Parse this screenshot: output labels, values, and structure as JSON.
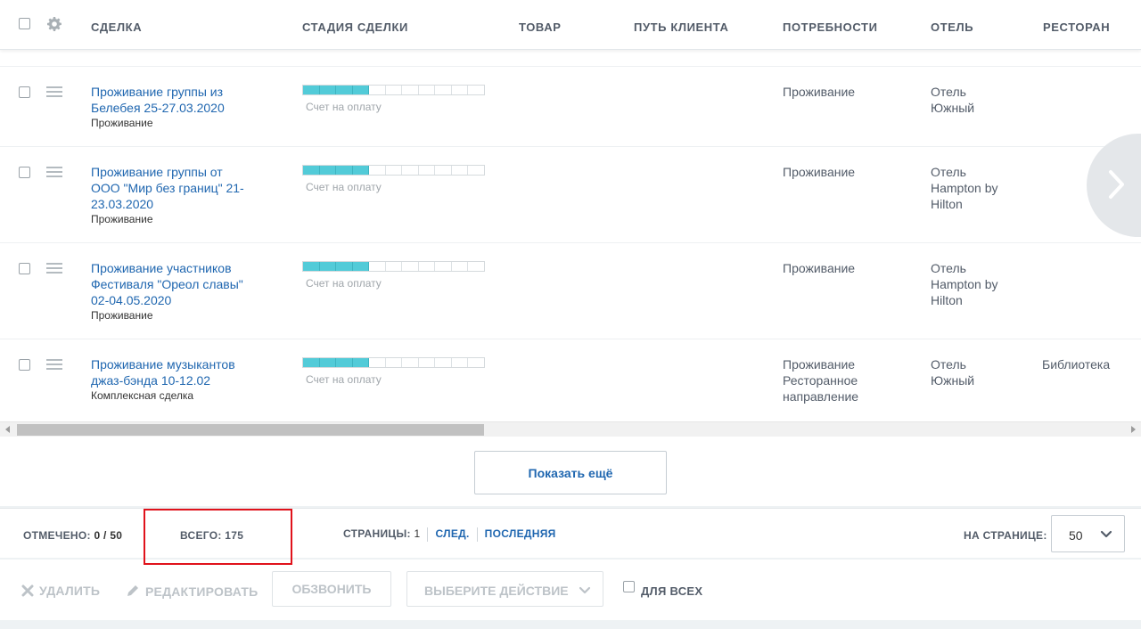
{
  "columns": {
    "deal": "СДЕЛКА",
    "stage": "СТАДИЯ СДЕЛКИ",
    "product": "ТОВАР",
    "journey": "ПУТЬ КЛИЕНТА",
    "needs": "ПОТРЕБНОСТИ",
    "hotel": "ОТЕЛЬ",
    "restaurant": "РЕСТОРАН"
  },
  "rows": [
    {
      "title_lines": [
        "Проживание группы из",
        "Белебея 25-27.03.2020"
      ],
      "type": "Проживание",
      "stage": "Счет на оплату",
      "stage_progress": {
        "filled": 4,
        "total": 11
      },
      "needs": [
        "Проживание"
      ],
      "hotel": [
        "Отель",
        "Южный"
      ],
      "restaurant": ""
    },
    {
      "title_lines": [
        "Проживание группы от",
        "ООО \"Мир без границ\" 21-",
        "23.03.2020"
      ],
      "type": "Проживание",
      "stage": "Счет на оплату",
      "stage_progress": {
        "filled": 4,
        "total": 11
      },
      "needs": [
        "Проживание"
      ],
      "hotel": [
        "Отель",
        "Hampton by",
        "Hilton"
      ],
      "restaurant": ""
    },
    {
      "title_lines": [
        "Проживание участников",
        "Фестиваля \"Ореол славы\"",
        "02-04.05.2020"
      ],
      "type": "Проживание",
      "stage": "Счет на оплату",
      "stage_progress": {
        "filled": 4,
        "total": 11
      },
      "needs": [
        "Проживание"
      ],
      "hotel": [
        "Отель",
        "Hampton by",
        "Hilton"
      ],
      "restaurant": ""
    },
    {
      "title_lines": [
        "Проживание музыкантов",
        "джаз-бэнда 10-12.02"
      ],
      "type": "Комплексная сделка",
      "stage": "Счет на оплату",
      "stage_progress": {
        "filled": 4,
        "total": 11
      },
      "needs": [
        "Проживание",
        "Ресторанное",
        "направление"
      ],
      "hotel": [
        "Отель",
        "Южный"
      ],
      "restaurant": "Библиотека"
    }
  ],
  "show_more_label": "Показать ещё",
  "footer": {
    "selected_label": "ОТМЕЧЕНО:",
    "selected_value": "0 / 50",
    "total_label": "ВСЕГО:",
    "total_value": "175",
    "pages_label": "СТРАНИЦЫ:",
    "current_page": "1",
    "next_label": "СЛЕД.",
    "last_label": "ПОСЛЕДНЯЯ",
    "per_page_label": "НА СТРАНИЦЕ:",
    "per_page_value": "50"
  },
  "actions": {
    "delete": "УДАЛИТЬ",
    "edit": "РЕДАКТИРОВАТЬ",
    "call": "ОБЗВОНИТЬ",
    "choose_action": "ВЫБЕРИТЕ ДЕЙСТВИЕ",
    "for_all": "ДЛЯ ВСЕХ"
  },
  "colors": {
    "link": "#2067b0",
    "stage_fill": "#52cbd8",
    "highlight": "#e0121b"
  },
  "icons": {
    "header_settings": "gear-icon",
    "row_handle": "drag-handle-icon",
    "next": "chevron-right-icon",
    "delete": "close-icon",
    "edit": "pencil-icon",
    "dropdown": "chevron-down-icon"
  }
}
